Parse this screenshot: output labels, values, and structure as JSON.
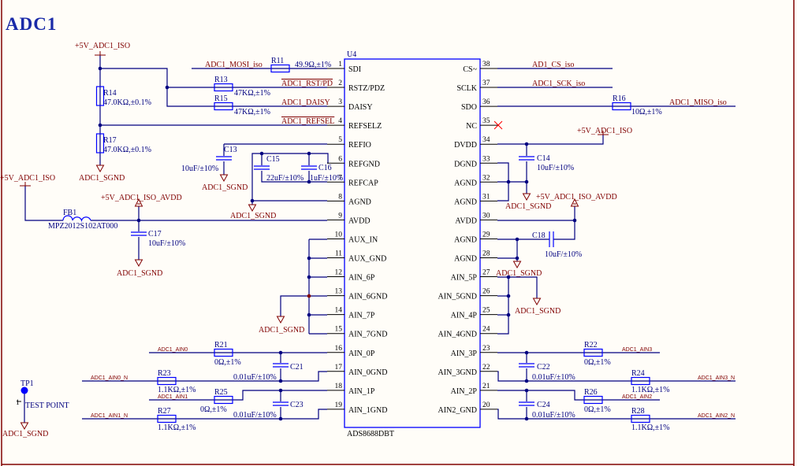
{
  "sheet": {
    "title": "ADC1"
  },
  "chip": {
    "ref": "U4",
    "part": "ADS8688DBT",
    "left_pins": [
      {
        "num": "1",
        "name": "SDI"
      },
      {
        "num": "2",
        "name": "RSTZ/PDZ"
      },
      {
        "num": "3",
        "name": "DAISY"
      },
      {
        "num": "4",
        "name": "REFSELZ"
      },
      {
        "num": "5",
        "name": "REFIO"
      },
      {
        "num": "6",
        "name": "REFGND"
      },
      {
        "num": "7",
        "name": "REFCAP"
      },
      {
        "num": "8",
        "name": "AGND"
      },
      {
        "num": "9",
        "name": "AVDD"
      },
      {
        "num": "10",
        "name": "AUX_IN"
      },
      {
        "num": "11",
        "name": "AUX_GND"
      },
      {
        "num": "12",
        "name": "AIN_6P"
      },
      {
        "num": "13",
        "name": "AIN_6GND"
      },
      {
        "num": "14",
        "name": "AIN_7P"
      },
      {
        "num": "15",
        "name": "AIN_7GND"
      },
      {
        "num": "16",
        "name": "AIN_0P"
      },
      {
        "num": "17",
        "name": "AIN_0GND"
      },
      {
        "num": "18",
        "name": "AIN_1P"
      },
      {
        "num": "19",
        "name": "AIN_1GND"
      }
    ],
    "right_pins": [
      {
        "num": "38",
        "name": "CS~"
      },
      {
        "num": "37",
        "name": "SCLK"
      },
      {
        "num": "36",
        "name": "SDO"
      },
      {
        "num": "35",
        "name": "NC"
      },
      {
        "num": "34",
        "name": "DVDD"
      },
      {
        "num": "33",
        "name": "DGND"
      },
      {
        "num": "32",
        "name": "AGND"
      },
      {
        "num": "31",
        "name": "AGND"
      },
      {
        "num": "30",
        "name": "AVDD"
      },
      {
        "num": "29",
        "name": "AGND"
      },
      {
        "num": "28",
        "name": "AGND"
      },
      {
        "num": "27",
        "name": "AIN_5P"
      },
      {
        "num": "26",
        "name": "AIN_5GND"
      },
      {
        "num": "25",
        "name": "AIN_4P"
      },
      {
        "num": "24",
        "name": "AIN_4GND"
      },
      {
        "num": "23",
        "name": "AIN_3P"
      },
      {
        "num": "22",
        "name": "AIN_3GND"
      },
      {
        "num": "21",
        "name": "AIN_2P"
      },
      {
        "num": "20",
        "name": "AIN2_GND"
      }
    ]
  },
  "nets": {
    "vcc_iso": "+5V_ADC1_ISO",
    "avdd": "+5V_ADC1_ISO_AVDD",
    "sgnd": "ADC1_SGND",
    "mosi": "ADC1_MOSI_iso",
    "rst": "ADC1_RST/PD",
    "daisy": "ADC1_DAISY",
    "refsel": "ADC1_REFSEL",
    "cs": "AD1_CS_iso",
    "sck": "ADC1_SCK_iso",
    "miso": "ADC1_MISO_iso",
    "ain0": "ADC1_AIN0",
    "ain0n": "ADC1_AIN0_N",
    "ain1": "ADC1_AIN1",
    "ain1n": "ADC1_AIN1_N",
    "ain3": "ADC1_AIN3",
    "ain3n": "ADC1_AIN3_N",
    "ain2": "ADC1_AIN2",
    "ain2n": "ADC1_AIN2_N"
  },
  "components": {
    "R11": {
      "ref": "R11",
      "value": "49.9Ω,±1%"
    },
    "R13": {
      "ref": "R13",
      "value": "47KΩ,±1%"
    },
    "R15": {
      "ref": "R15",
      "value": "47KΩ,±1%"
    },
    "R14": {
      "ref": "R14",
      "value": "47.0KΩ,±0.1%"
    },
    "R17": {
      "ref": "R17",
      "value": "47.0KΩ,±0.1%"
    },
    "R16": {
      "ref": "R16",
      "value": "10Ω,±1%"
    },
    "R21": {
      "ref": "R21",
      "value": "0Ω,±1%"
    },
    "R23": {
      "ref": "R23",
      "value": "1.1KΩ,±1%"
    },
    "R25": {
      "ref": "R25",
      "value": "0Ω,±1%"
    },
    "R27": {
      "ref": "R27",
      "value": "1.1KΩ,±1%"
    },
    "R22": {
      "ref": "R22",
      "value": "0Ω,±1%"
    },
    "R24": {
      "ref": "R24",
      "value": "1.1KΩ,±1%"
    },
    "R26": {
      "ref": "R26",
      "value": "0Ω,±1%"
    },
    "R28": {
      "ref": "R28",
      "value": "1.1KΩ,±1%"
    },
    "C13": {
      "ref": "C13",
      "value": "10uF/±10%"
    },
    "C14": {
      "ref": "C14",
      "value": "10uF/±10%"
    },
    "C15": {
      "ref": "C15",
      "value": "22uF/±10%"
    },
    "C16": {
      "ref": "C16",
      "value": "1uF/±10%"
    },
    "C17": {
      "ref": "C17",
      "value": "10uF/±10%"
    },
    "C18": {
      "ref": "C18",
      "value": "10uF/±10%"
    },
    "C21": {
      "ref": "C21",
      "value": "0.01uF/±10%"
    },
    "C22": {
      "ref": "C22",
      "value": "0.01uF/±10%"
    },
    "C23": {
      "ref": "C23",
      "value": "0.01uF/±10%"
    },
    "C24": {
      "ref": "C24",
      "value": "0.01uF/±10%"
    },
    "FB1": {
      "ref": "FB1",
      "value": "MPZ2012S102AT000"
    },
    "TP1": {
      "ref": "TP1",
      "value": "TEST POINT",
      "pin": "1"
    }
  },
  "colors": {
    "wire": "#000080",
    "part": "#0000ff",
    "label": "#800000",
    "title": "#1a2aa8",
    "nc_marker": "#ff0000"
  }
}
